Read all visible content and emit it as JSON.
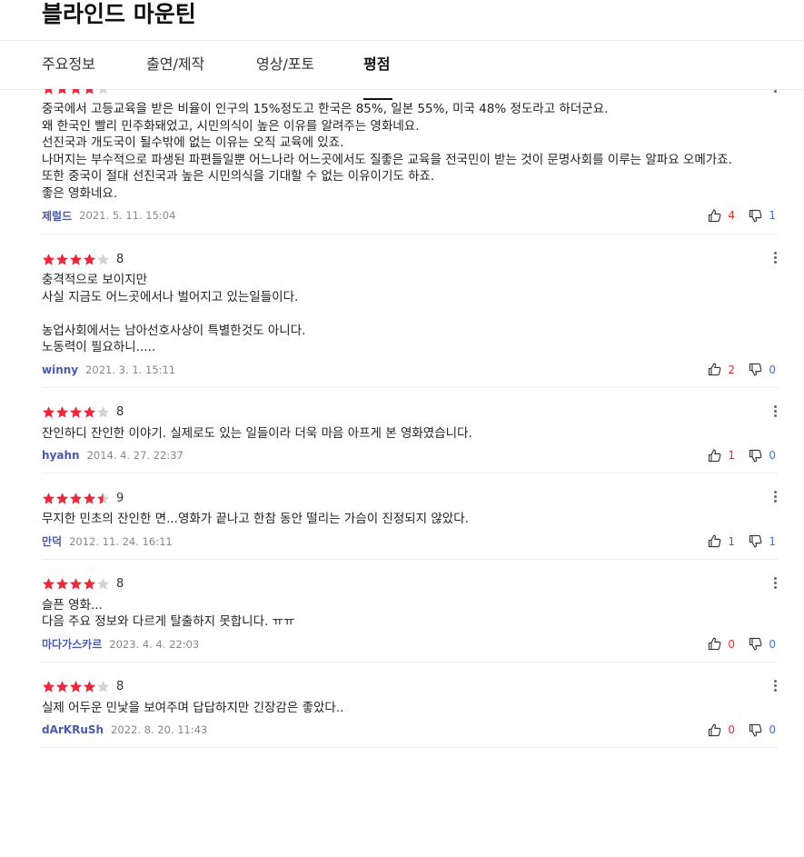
{
  "page": {
    "title": "블라인드 마운틴",
    "tabs": [
      "주요정보",
      "출연/제작",
      "영상/포토",
      "평점"
    ],
    "active_tab": 3
  },
  "colors": {
    "star_on": "#e8283b",
    "star_off": "#d3d3d3",
    "author": "#4a5aa8",
    "like": "#e03131",
    "dislike": "#4a6fc8"
  },
  "icons": {
    "like": "thumb-up-icon",
    "dislike": "thumb-down-icon",
    "more": "more-vertical-icon",
    "star": "star-icon"
  },
  "reviews": [
    {
      "stars": 4,
      "score": "",
      "content": "중국에서 고등교육을 받은 비율이 인구의 15%정도고 한국은 85%, 일본 55%, 미국 48% 정도라고 하더군요.\n왜 한국인 빨리 민주화돼었고, 시민의식이 높은 이유를 알려주는 영화네요.\n선진국과 개도국이 될수밖에 없는 이유는 오직 교육에 있죠.\n나머지는 부수적으로 파생된 파편들일뿐 어느나라 어느곳에서도 질좋은 교육을 전국민이 받는 것이 문명사회를 이루는 알파요 오메가죠.\n또한 중국이 절대 선진국과 높은 시민의식을 기대할 수 없는 이유이기도 하죠.\n좋은 영화네요.",
      "author": "제럴드",
      "date": "2021. 5. 11. 15:04",
      "likes": "4",
      "dislikes": "1"
    },
    {
      "stars": 4,
      "score": "8",
      "content": "충격적으로 보이지만\n사실 지금도 어느곳에서나 벌어지고 있는일들이다.\n\n농업사회에서는 남아선호사상이 특별한것도 아니다.\n노동력이 필요하니.....",
      "author": "winny",
      "date": "2021. 3. 1. 15:11",
      "likes": "2",
      "dislikes": "0"
    },
    {
      "stars": 4,
      "score": "8",
      "content": "잔인하디 잔인한 이야기. 실제로도 있는 일들이라 더욱 마음 아프게 본 영화였습니다.",
      "author": "hyahn",
      "date": "2014. 4. 27. 22:37",
      "likes": "1",
      "dislikes": "0"
    },
    {
      "stars": 4.5,
      "score": "9",
      "content": "무지한 민초의 잔인한 면...영화가 끝나고 한참 동안 떨리는 가슴이 진정되지 않았다.",
      "author": "만덕",
      "date": "2012. 11. 24. 16:11",
      "likes": "1",
      "dislikes": "1"
    },
    {
      "stars": 4,
      "score": "8",
      "content": "슬픈 영화...\n다음 주요 정보와 다르게 탈출하지 못합니다. ㅠㅠ",
      "author": "마다가스카르",
      "date": "2023. 4. 4. 22:03",
      "likes": "0",
      "dislikes": "0"
    },
    {
      "stars": 4,
      "score": "8",
      "content": "실제 어두운 민낯을 보여주며 답답하지만 긴장감은 좋았다..",
      "author": "dArKRuSh",
      "date": "2022. 8. 20. 11:43",
      "likes": "0",
      "dislikes": "0"
    }
  ]
}
